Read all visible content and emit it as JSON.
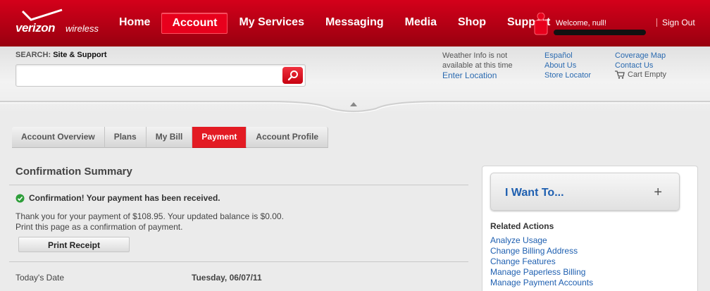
{
  "header": {
    "logo_brand": "verizon",
    "logo_sub": "wireless",
    "nav": [
      "Home",
      "Account",
      "My Services",
      "Messaging",
      "Media",
      "Shop",
      "Support"
    ],
    "active_nav": "Account",
    "welcome": "Welcome, null!",
    "sign_out": "Sign Out"
  },
  "search": {
    "label_prefix": "SEARCH:",
    "label_scope": "Site & Support",
    "placeholder": ""
  },
  "weather": {
    "message_line1": "Weather Info is not",
    "message_line2": "available at this time",
    "link": "Enter Location"
  },
  "utility_links": {
    "col1": [
      "Español",
      "About Us",
      "Store Locator"
    ],
    "col2": [
      "Coverage Map",
      "Contact Us"
    ],
    "cart": "Cart Empty"
  },
  "tabs": [
    "Account Overview",
    "Plans",
    "My Bill",
    "Payment",
    "Account Profile"
  ],
  "active_tab": "Payment",
  "main": {
    "title": "Confirmation Summary",
    "confirmation": "Confirmation! Your payment has been received.",
    "thanks_line1": "Thank you for your payment of $108.95. Your updated balance is $0.00.",
    "thanks_line2": "Print this page as a confirmation of payment.",
    "print_button": "Print Receipt",
    "date_label": "Today's Date",
    "date_value": "Tuesday, 06/07/11"
  },
  "sidebar": {
    "iwant": "I Want To...",
    "related_title": "Related Actions",
    "related": [
      "Analyze Usage",
      "Change Billing Address",
      "Change Features",
      "Manage Paperless Billing",
      "Manage Payment Accounts"
    ]
  },
  "colors": {
    "brand_red": "#d4001a",
    "link_blue": "#2a6ab0",
    "active_tab": "#e31b23",
    "success_green": "#2e9e3a"
  },
  "icons": [
    "verizon-check-icon",
    "person-icon",
    "search-icon",
    "cart-icon",
    "fold-arrow-icon",
    "checkmark-circle-icon",
    "plus-icon"
  ]
}
